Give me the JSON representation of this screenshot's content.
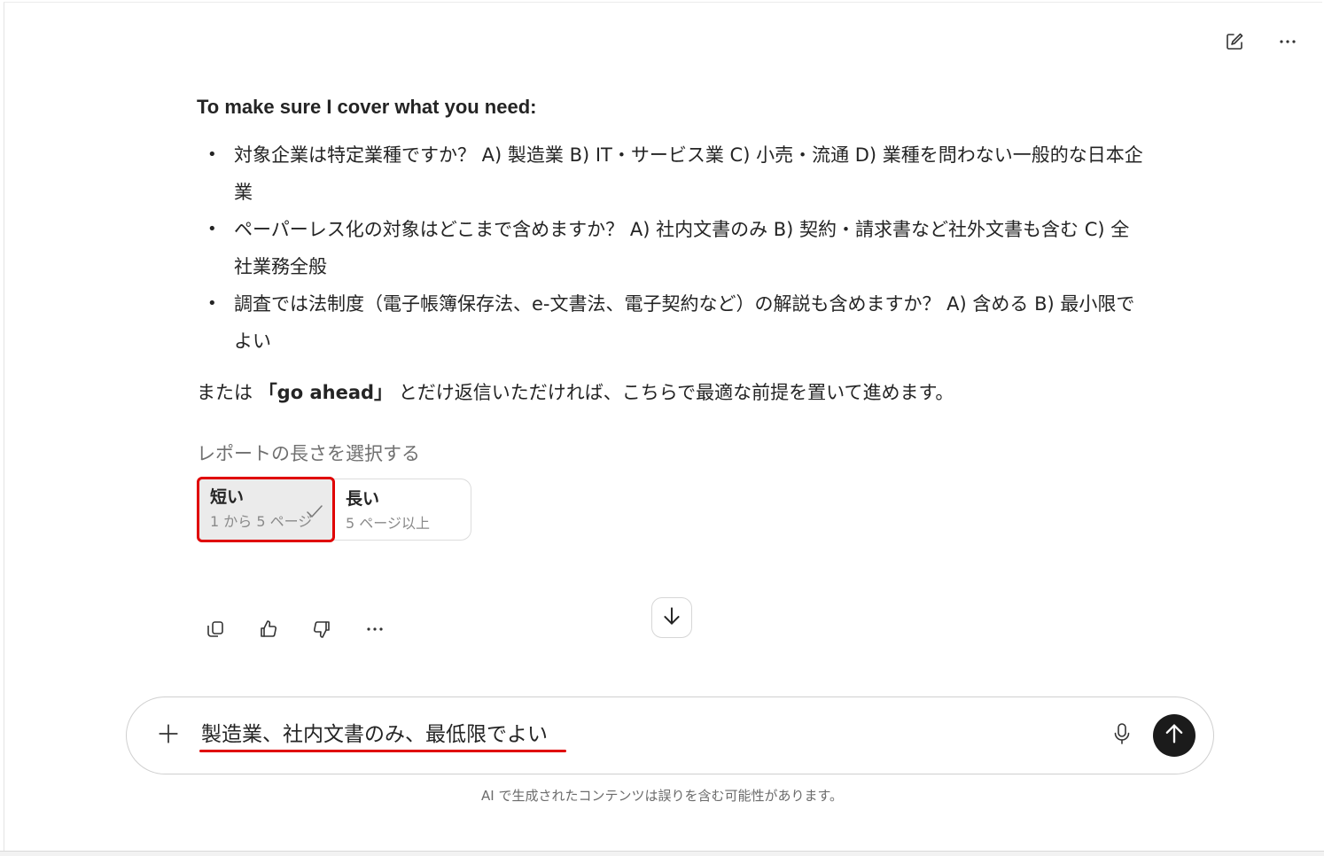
{
  "message": {
    "intro": "To make sure I cover what you need:",
    "questions": [
      "対象企業は特定業種ですか？ A) 製造業 B) IT・サービス業 C) 小売・流通 D) 業種を問わない一般的な日本企業",
      "ペーパーレス化の対象はどこまで含めますか？ A) 社内文書のみ B) 契約・請求書など社外文書も含む C) 全社業務全般",
      "調査では法制度（電子帳簿保存法、e-文書法、電子契約など）の解説も含めますか？ A) 含める B) 最小限でよい"
    ],
    "closing_prefix": "または ",
    "closing_bold": "「go ahead」",
    "closing_suffix": " とだけ返信いただければ、こちらで最適な前提を置いて進めます。"
  },
  "report_length": {
    "label": "レポートの長さを選択する",
    "options": [
      {
        "title": "短い",
        "subtitle": "1 から 5 ページ",
        "selected": true
      },
      {
        "title": "長い",
        "subtitle": "5 ページ以上",
        "selected": false
      }
    ]
  },
  "icons": {
    "new_chat": "edit-icon",
    "more": "more-icon",
    "copy": "copy-icon",
    "like": "thumbs-up-icon",
    "dislike": "thumbs-down-icon",
    "scroll": "arrow-down-icon",
    "add": "plus-icon",
    "mic": "microphone-icon",
    "send": "arrow-up-icon"
  },
  "composer": {
    "value": "製造業、社内文書のみ、最低限でよい"
  },
  "disclaimer": "AI で生成されたコンテンツは誤りを含む可能性があります。",
  "colors": {
    "highlight": "#e00000",
    "send_button": "#1b1b1b",
    "selected_bg": "#ebebeb"
  }
}
